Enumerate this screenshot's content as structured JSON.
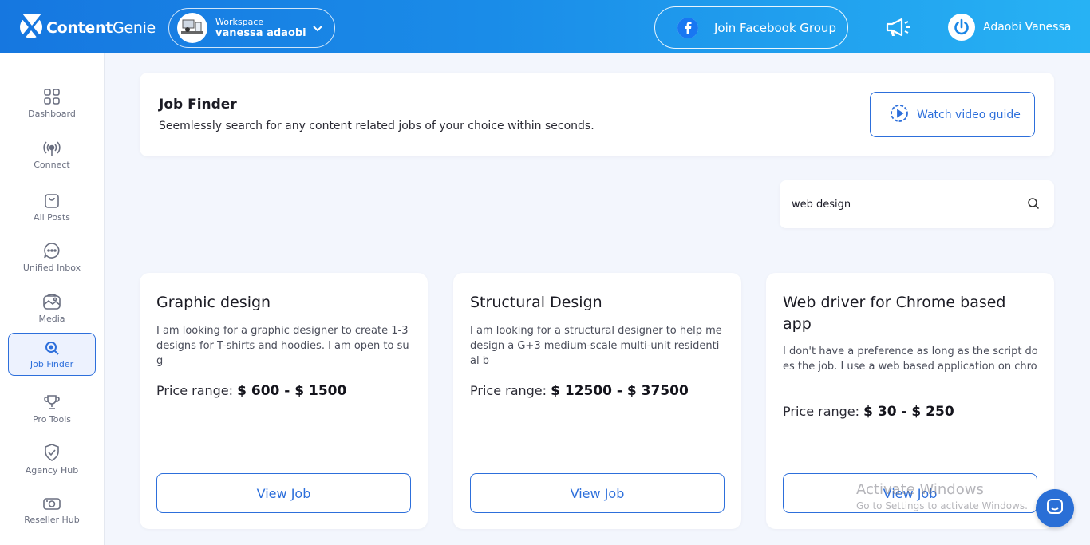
{
  "header": {
    "brand_bold": "Content",
    "brand_rest": "Genie",
    "workspace_label": "Workspace",
    "workspace_name": "vanessa adaobi",
    "facebook_button": "Join Facebook Group",
    "user_name": "Adaobi Vanessa"
  },
  "sidebar": {
    "items": [
      {
        "label": "Dashboard",
        "icon": "grid-icon"
      },
      {
        "label": "Connect",
        "icon": "broadcast-icon"
      },
      {
        "label": "All Posts",
        "icon": "bag-icon"
      },
      {
        "label": "Unified Inbox",
        "icon": "chat-bubble-icon"
      },
      {
        "label": "Media",
        "icon": "image-icon"
      },
      {
        "label": "Job Finder",
        "icon": "search-icon",
        "active": true
      },
      {
        "label": "Pro Tools",
        "icon": "trophy-icon"
      },
      {
        "label": "Agency Hub",
        "icon": "shield-check-icon"
      },
      {
        "label": "Reseller Hub",
        "icon": "camera-icon"
      }
    ]
  },
  "banner": {
    "title": "Job Finder",
    "subtitle": "Seemlessly search for any content related jobs of your choice within seconds.",
    "watch_button": "Watch video guide"
  },
  "search": {
    "value": "web design"
  },
  "jobs": [
    {
      "title": "Graphic design",
      "description": "I am looking for a graphic designer to create 1-3 designs for T-shirts and hoodies. I am open to sug",
      "price_label": "Price range:",
      "price_value": "$ 600 - $ 1500",
      "button": "View Job"
    },
    {
      "title": "Structural Design",
      "description": "I am looking for a structural designer to help me design a G+3 medium-scale multi-unit residential b",
      "price_label": "Price range:",
      "price_value": "$ 12500 - $ 37500",
      "button": "View Job"
    },
    {
      "title": "Web driver for Chrome based app",
      "description": "I don't have a preference as long as the script does the job. I use a web based application on chro",
      "price_label": "Price range:",
      "price_value": "$ 30 - $ 250",
      "button": "View Job"
    }
  ],
  "watermark": {
    "line1": "Activate Windows",
    "line2": "Go to Settings to activate Windows."
  },
  "colors": {
    "accent": "#2d6fdb",
    "header_start": "#1677e0",
    "header_end": "#27b2f4",
    "background": "#f3f6fd"
  }
}
